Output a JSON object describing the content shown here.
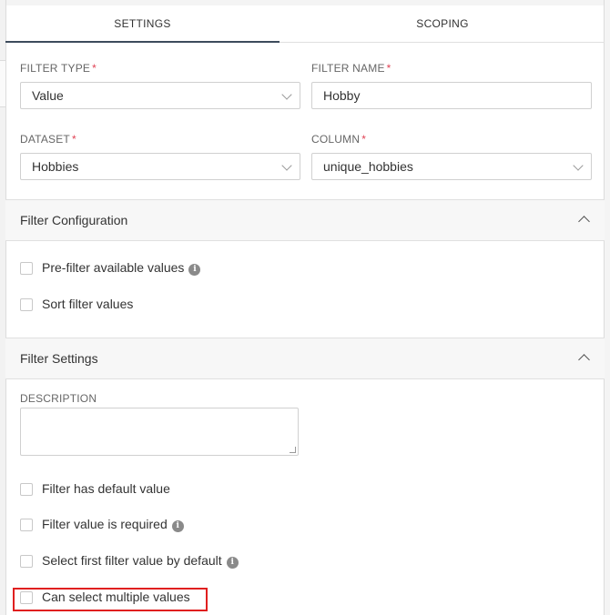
{
  "tabs": [
    {
      "label": "SETTINGS",
      "active": true
    },
    {
      "label": "SCOPING",
      "active": false
    }
  ],
  "form": {
    "filter_type": {
      "label": "FILTER TYPE",
      "required_mark": "*",
      "value": "Value"
    },
    "filter_name": {
      "label": "FILTER NAME",
      "required_mark": "*",
      "value": "Hobby"
    },
    "dataset": {
      "label": "DATASET",
      "required_mark": "*",
      "value": "Hobbies"
    },
    "column": {
      "label": "COLUMN",
      "required_mark": "*",
      "value": "unique_hobbies"
    }
  },
  "filter_configuration": {
    "title": "Filter Configuration",
    "options": [
      {
        "label": "Pre-filter available values",
        "checked": false,
        "has_info": true
      },
      {
        "label": "Sort filter values",
        "checked": false,
        "has_info": false
      }
    ]
  },
  "filter_settings": {
    "title": "Filter Settings",
    "description_label": "DESCRIPTION",
    "description_value": "",
    "options": [
      {
        "label": "Filter has default value",
        "checked": false,
        "has_info": false
      },
      {
        "label": "Filter value is required",
        "checked": false,
        "has_info": true
      },
      {
        "label": "Select first filter value by default",
        "checked": false,
        "has_info": true
      },
      {
        "label": "Can select multiple values",
        "checked": false,
        "has_info": false,
        "highlighted": true
      }
    ]
  },
  "icons": {
    "info": "i"
  },
  "colors": {
    "required": "#e04355",
    "highlight": "#e01f1f",
    "tab_underline": "#3d4b5c"
  }
}
